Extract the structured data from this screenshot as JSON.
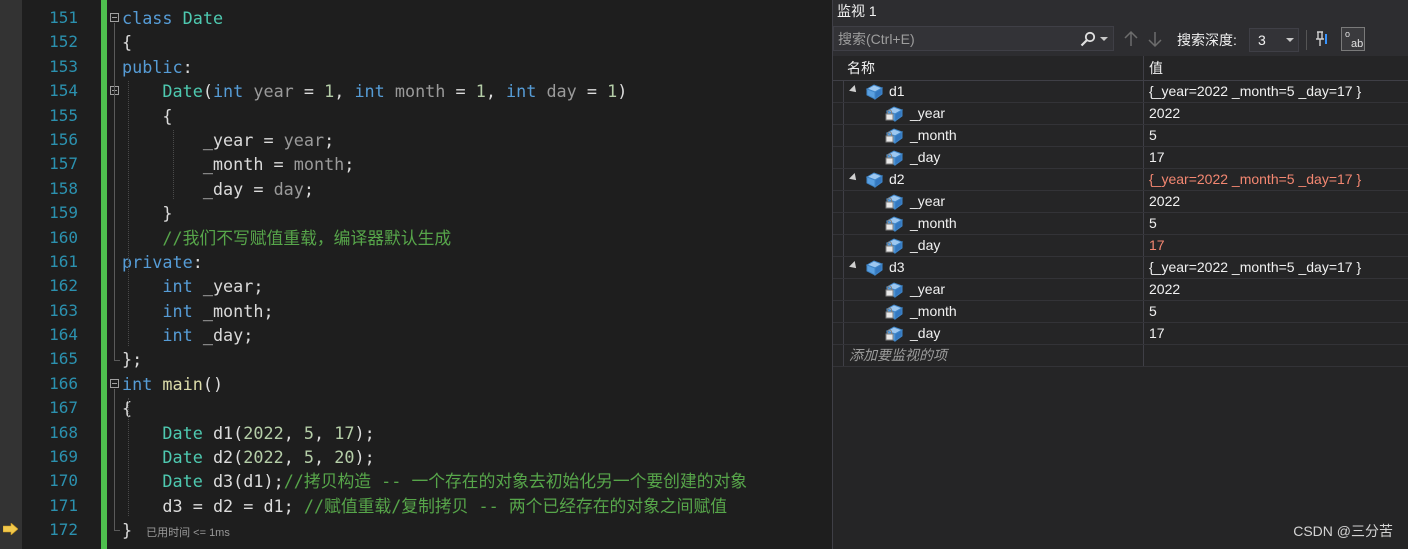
{
  "editor": {
    "first_line_number": 151,
    "current_line": 172,
    "performance_hint": "已用时间 <= 1ms",
    "lines": [
      {
        "n": "151",
        "segs": [
          [
            "kw",
            "class"
          ],
          [
            "lbl",
            " "
          ],
          [
            "ty",
            "Date"
          ]
        ]
      },
      {
        "n": "152",
        "segs": [
          [
            "lbl",
            "{"
          ]
        ]
      },
      {
        "n": "153",
        "segs": [
          [
            "kw",
            "public"
          ],
          [
            "lbl",
            ":"
          ]
        ]
      },
      {
        "n": "154",
        "segs": [
          [
            "lbl",
            "    "
          ],
          [
            "ty",
            "Date"
          ],
          [
            "lbl",
            "("
          ],
          [
            "kw",
            "int"
          ],
          [
            "lbl",
            " "
          ],
          [
            "prm",
            "year"
          ],
          [
            "lbl",
            " = "
          ],
          [
            "num",
            "1"
          ],
          [
            "lbl",
            ", "
          ],
          [
            "kw",
            "int"
          ],
          [
            "lbl",
            " "
          ],
          [
            "prm",
            "month"
          ],
          [
            "lbl",
            " = "
          ],
          [
            "num",
            "1"
          ],
          [
            "lbl",
            ", "
          ],
          [
            "kw",
            "int"
          ],
          [
            "lbl",
            " "
          ],
          [
            "prm",
            "day"
          ],
          [
            "lbl",
            " = "
          ],
          [
            "num",
            "1"
          ],
          [
            "lbl",
            ")"
          ]
        ]
      },
      {
        "n": "155",
        "segs": [
          [
            "lbl",
            "    {"
          ]
        ]
      },
      {
        "n": "156",
        "segs": [
          [
            "lbl",
            "        "
          ],
          [
            "mem",
            "_year"
          ],
          [
            "lbl",
            " = "
          ],
          [
            "prm",
            "year"
          ],
          [
            "lbl",
            ";"
          ]
        ]
      },
      {
        "n": "157",
        "segs": [
          [
            "lbl",
            "        "
          ],
          [
            "mem",
            "_month"
          ],
          [
            "lbl",
            " = "
          ],
          [
            "prm",
            "month"
          ],
          [
            "lbl",
            ";"
          ]
        ]
      },
      {
        "n": "158",
        "segs": [
          [
            "lbl",
            "        "
          ],
          [
            "mem",
            "_day"
          ],
          [
            "lbl",
            " = "
          ],
          [
            "prm",
            "day"
          ],
          [
            "lbl",
            ";"
          ]
        ]
      },
      {
        "n": "159",
        "segs": [
          [
            "lbl",
            "    }"
          ]
        ]
      },
      {
        "n": "160",
        "segs": [
          [
            "lbl",
            "    "
          ],
          [
            "cm",
            "//我们不写赋值重载，编译器默认生成"
          ]
        ]
      },
      {
        "n": "161",
        "segs": [
          [
            "kw",
            "private"
          ],
          [
            "lbl",
            ":"
          ]
        ]
      },
      {
        "n": "162",
        "segs": [
          [
            "lbl",
            "    "
          ],
          [
            "kw",
            "int"
          ],
          [
            "lbl",
            " "
          ],
          [
            "mem",
            "_year"
          ],
          [
            "lbl",
            ";"
          ]
        ]
      },
      {
        "n": "163",
        "segs": [
          [
            "lbl",
            "    "
          ],
          [
            "kw",
            "int"
          ],
          [
            "lbl",
            " "
          ],
          [
            "mem",
            "_month"
          ],
          [
            "lbl",
            ";"
          ]
        ]
      },
      {
        "n": "164",
        "segs": [
          [
            "lbl",
            "    "
          ],
          [
            "kw",
            "int"
          ],
          [
            "lbl",
            " "
          ],
          [
            "mem",
            "_day"
          ],
          [
            "lbl",
            ";"
          ]
        ]
      },
      {
        "n": "165",
        "segs": [
          [
            "lbl",
            "};"
          ]
        ]
      },
      {
        "n": "166",
        "segs": [
          [
            "kw",
            "int"
          ],
          [
            "lbl",
            " "
          ],
          [
            "fn",
            "main"
          ],
          [
            "lbl",
            "()"
          ]
        ]
      },
      {
        "n": "167",
        "segs": [
          [
            "lbl",
            "{"
          ]
        ]
      },
      {
        "n": "168",
        "segs": [
          [
            "lbl",
            "    "
          ],
          [
            "ty",
            "Date"
          ],
          [
            "lbl",
            " "
          ],
          [
            "lbl",
            "d1"
          ],
          [
            "lbl",
            "("
          ],
          [
            "num",
            "2022"
          ],
          [
            "lbl",
            ", "
          ],
          [
            "num",
            "5"
          ],
          [
            "lbl",
            ", "
          ],
          [
            "num",
            "17"
          ],
          [
            "lbl",
            ");"
          ]
        ]
      },
      {
        "n": "169",
        "segs": [
          [
            "lbl",
            "    "
          ],
          [
            "ty",
            "Date"
          ],
          [
            "lbl",
            " "
          ],
          [
            "lbl",
            "d2"
          ],
          [
            "lbl",
            "("
          ],
          [
            "num",
            "2022"
          ],
          [
            "lbl",
            ", "
          ],
          [
            "num",
            "5"
          ],
          [
            "lbl",
            ", "
          ],
          [
            "num",
            "20"
          ],
          [
            "lbl",
            ");"
          ]
        ]
      },
      {
        "n": "170",
        "segs": [
          [
            "lbl",
            "    "
          ],
          [
            "ty",
            "Date"
          ],
          [
            "lbl",
            " "
          ],
          [
            "lbl",
            "d3"
          ],
          [
            "lbl",
            "(d1);"
          ],
          [
            "cm",
            "//拷贝构造 -- 一个存在的对象去初始化另一个要创建的对象"
          ]
        ]
      },
      {
        "n": "171",
        "segs": [
          [
            "lbl",
            "    "
          ],
          [
            "lbl",
            "d3 = d2 = d1; "
          ],
          [
            "cm",
            "//赋值重载/复制拷贝 -- 两个已经存在的对象之间赋值"
          ]
        ]
      },
      {
        "n": "172",
        "segs": [
          [
            "lbl",
            "}"
          ]
        ]
      }
    ]
  },
  "watch": {
    "title": "监视 1",
    "search_placeholder": "搜索(Ctrl+E)",
    "depth_label": "搜索深度:",
    "depth_value": "3",
    "col_name": "名称",
    "col_value": "值",
    "add_placeholder": "添加要监视的项",
    "rows": [
      {
        "name": "d1",
        "value": "{_year=2022 _month=5 _day=17 }",
        "level": 0,
        "changed": false
      },
      {
        "name": "_year",
        "value": "2022",
        "level": 1,
        "changed": false
      },
      {
        "name": "_month",
        "value": "5",
        "level": 1,
        "changed": false
      },
      {
        "name": "_day",
        "value": "17",
        "level": 1,
        "changed": false
      },
      {
        "name": "d2",
        "value": "{_year=2022 _month=5 _day=17 }",
        "level": 0,
        "changed": true
      },
      {
        "name": "_year",
        "value": "2022",
        "level": 1,
        "changed": false
      },
      {
        "name": "_month",
        "value": "5",
        "level": 1,
        "changed": false
      },
      {
        "name": "_day",
        "value": "17",
        "level": 1,
        "changed": true
      },
      {
        "name": "d3",
        "value": "{_year=2022 _month=5 _day=17 }",
        "level": 0,
        "changed": false
      },
      {
        "name": "_year",
        "value": "2022",
        "level": 1,
        "changed": false
      },
      {
        "name": "_month",
        "value": "5",
        "level": 1,
        "changed": false
      },
      {
        "name": "_day",
        "value": "17",
        "level": 1,
        "changed": false
      }
    ]
  },
  "watermark": "CSDN @三分苦",
  "colors": {
    "keyword": "#569cd6",
    "type": "#4ec9b0",
    "function": "#dcdcaa",
    "number": "#b5cea8",
    "comment": "#57a64a",
    "line_number": "#2b91af",
    "change_bar": "#4ec04e",
    "changed_value": "#f48771",
    "current_line_arrow": "#f2c94c"
  },
  "icons": {
    "search": "search-icon",
    "pin": "pin-icon",
    "hex": "hex-display-icon",
    "variable": "variable-icon",
    "member": "private-field-icon"
  }
}
